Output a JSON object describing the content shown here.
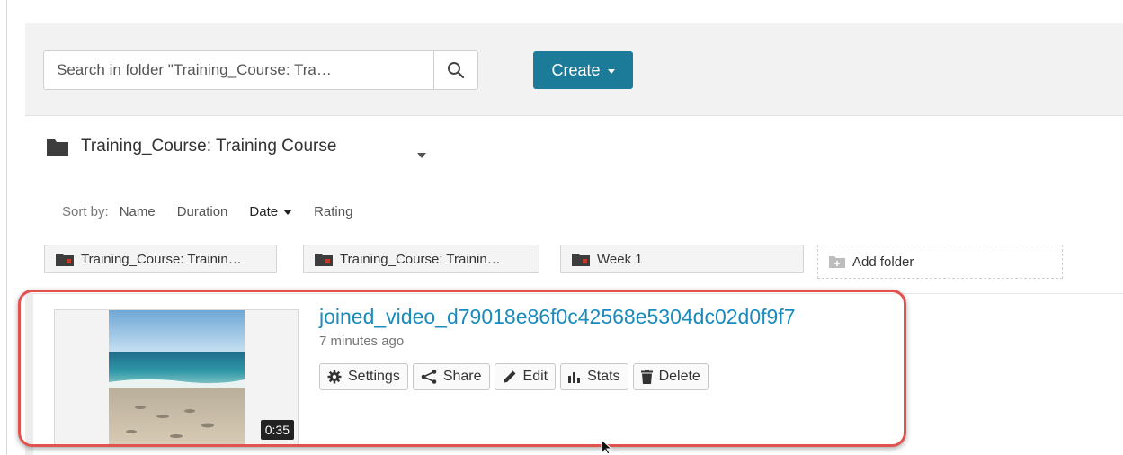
{
  "search": {
    "placeholder": "Search in folder \"Training_Course: Tra…"
  },
  "toolbar": {
    "create_label": "Create"
  },
  "folder": {
    "title": "Training_Course: Training Course"
  },
  "sort": {
    "label": "Sort by:",
    "options": [
      "Name",
      "Duration",
      "Date",
      "Rating"
    ],
    "active": "Date"
  },
  "subfolders": [
    {
      "label": "Training_Course: Trainin…"
    },
    {
      "label": "Training_Course: Trainin…"
    },
    {
      "label": "Week 1"
    }
  ],
  "add_folder_label": "Add folder",
  "video": {
    "title": "joined_video_d79018e86f0c42568e5304dc02d0f9f7",
    "time_ago": "7 minutes ago",
    "duration": "0:35",
    "actions": [
      "Settings",
      "Share",
      "Edit",
      "Stats",
      "Delete"
    ]
  },
  "colors": {
    "accent": "#1d7b9a",
    "link": "#1a8bbd",
    "highlight": "#e0534f",
    "folder_icon": "#3d3d3d",
    "folder_mark": "#c0392b"
  }
}
